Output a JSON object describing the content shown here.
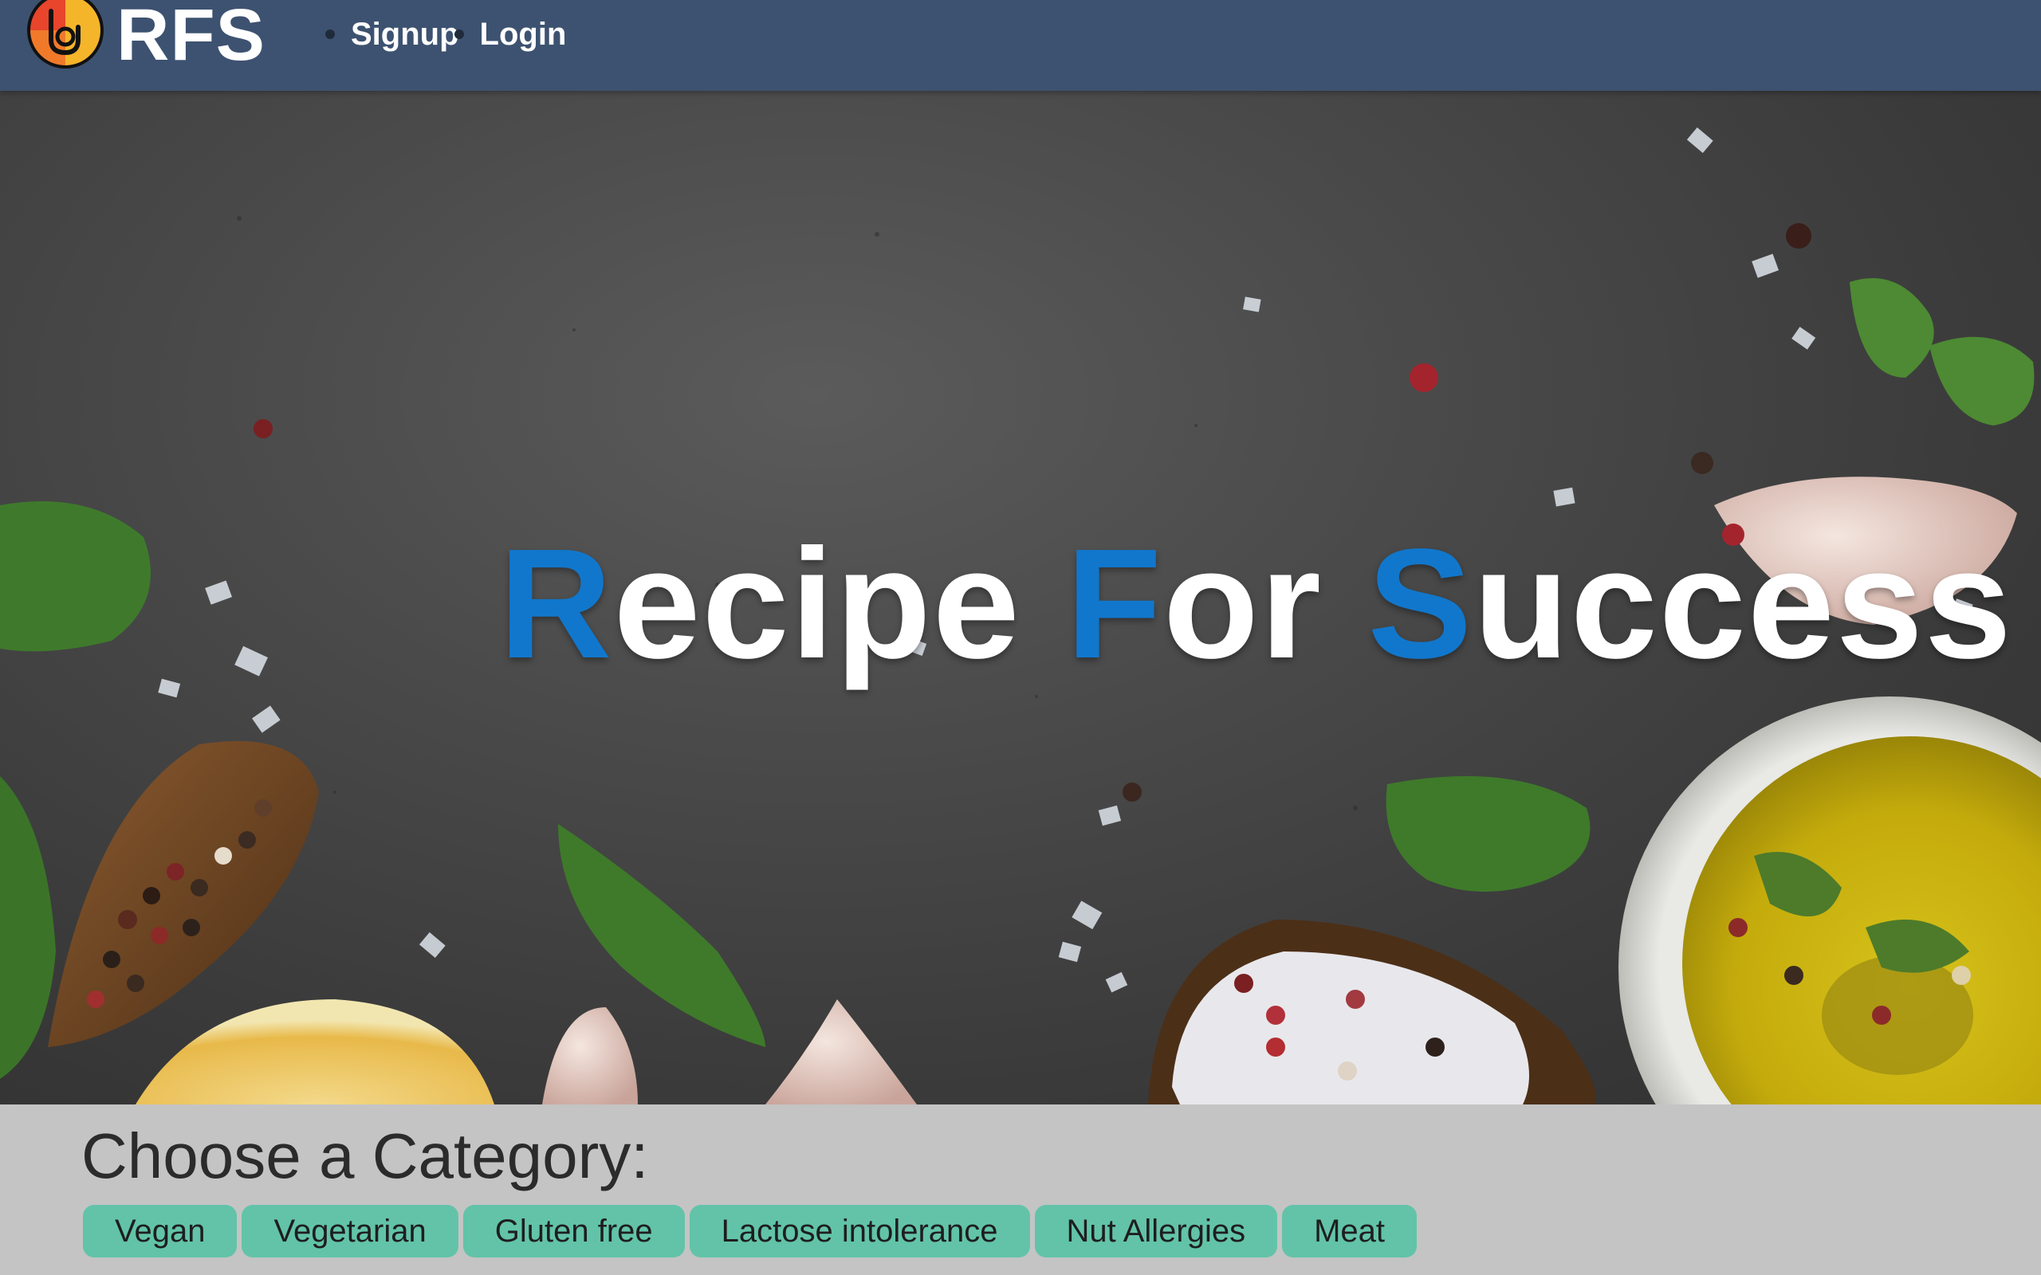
{
  "header": {
    "brand": "RFS",
    "logo_icon": "rfs-hand-logo-icon",
    "nav": [
      {
        "label": "Signup"
      },
      {
        "label": "Login"
      }
    ],
    "colors": {
      "bar": "#3d5270",
      "text": "#ffffff"
    }
  },
  "hero": {
    "title_parts": {
      "r": "R",
      "ecipe": "ecipe",
      "f": "F",
      "or": "or",
      "s": "S",
      "uccess": "uccess"
    },
    "background": "dark slate with herbs, spices, garlic, lemon, salt and olive oil",
    "accent_color": "#1177cc"
  },
  "categories": {
    "heading": "Choose a Category:",
    "items": [
      {
        "label": "Vegan"
      },
      {
        "label": "Vegetarian"
      },
      {
        "label": "Gluten free"
      },
      {
        "label": "Lactose intolerance"
      },
      {
        "label": "Nut Allergies"
      },
      {
        "label": "Meat"
      }
    ],
    "chip_color": "#62c3a8"
  }
}
